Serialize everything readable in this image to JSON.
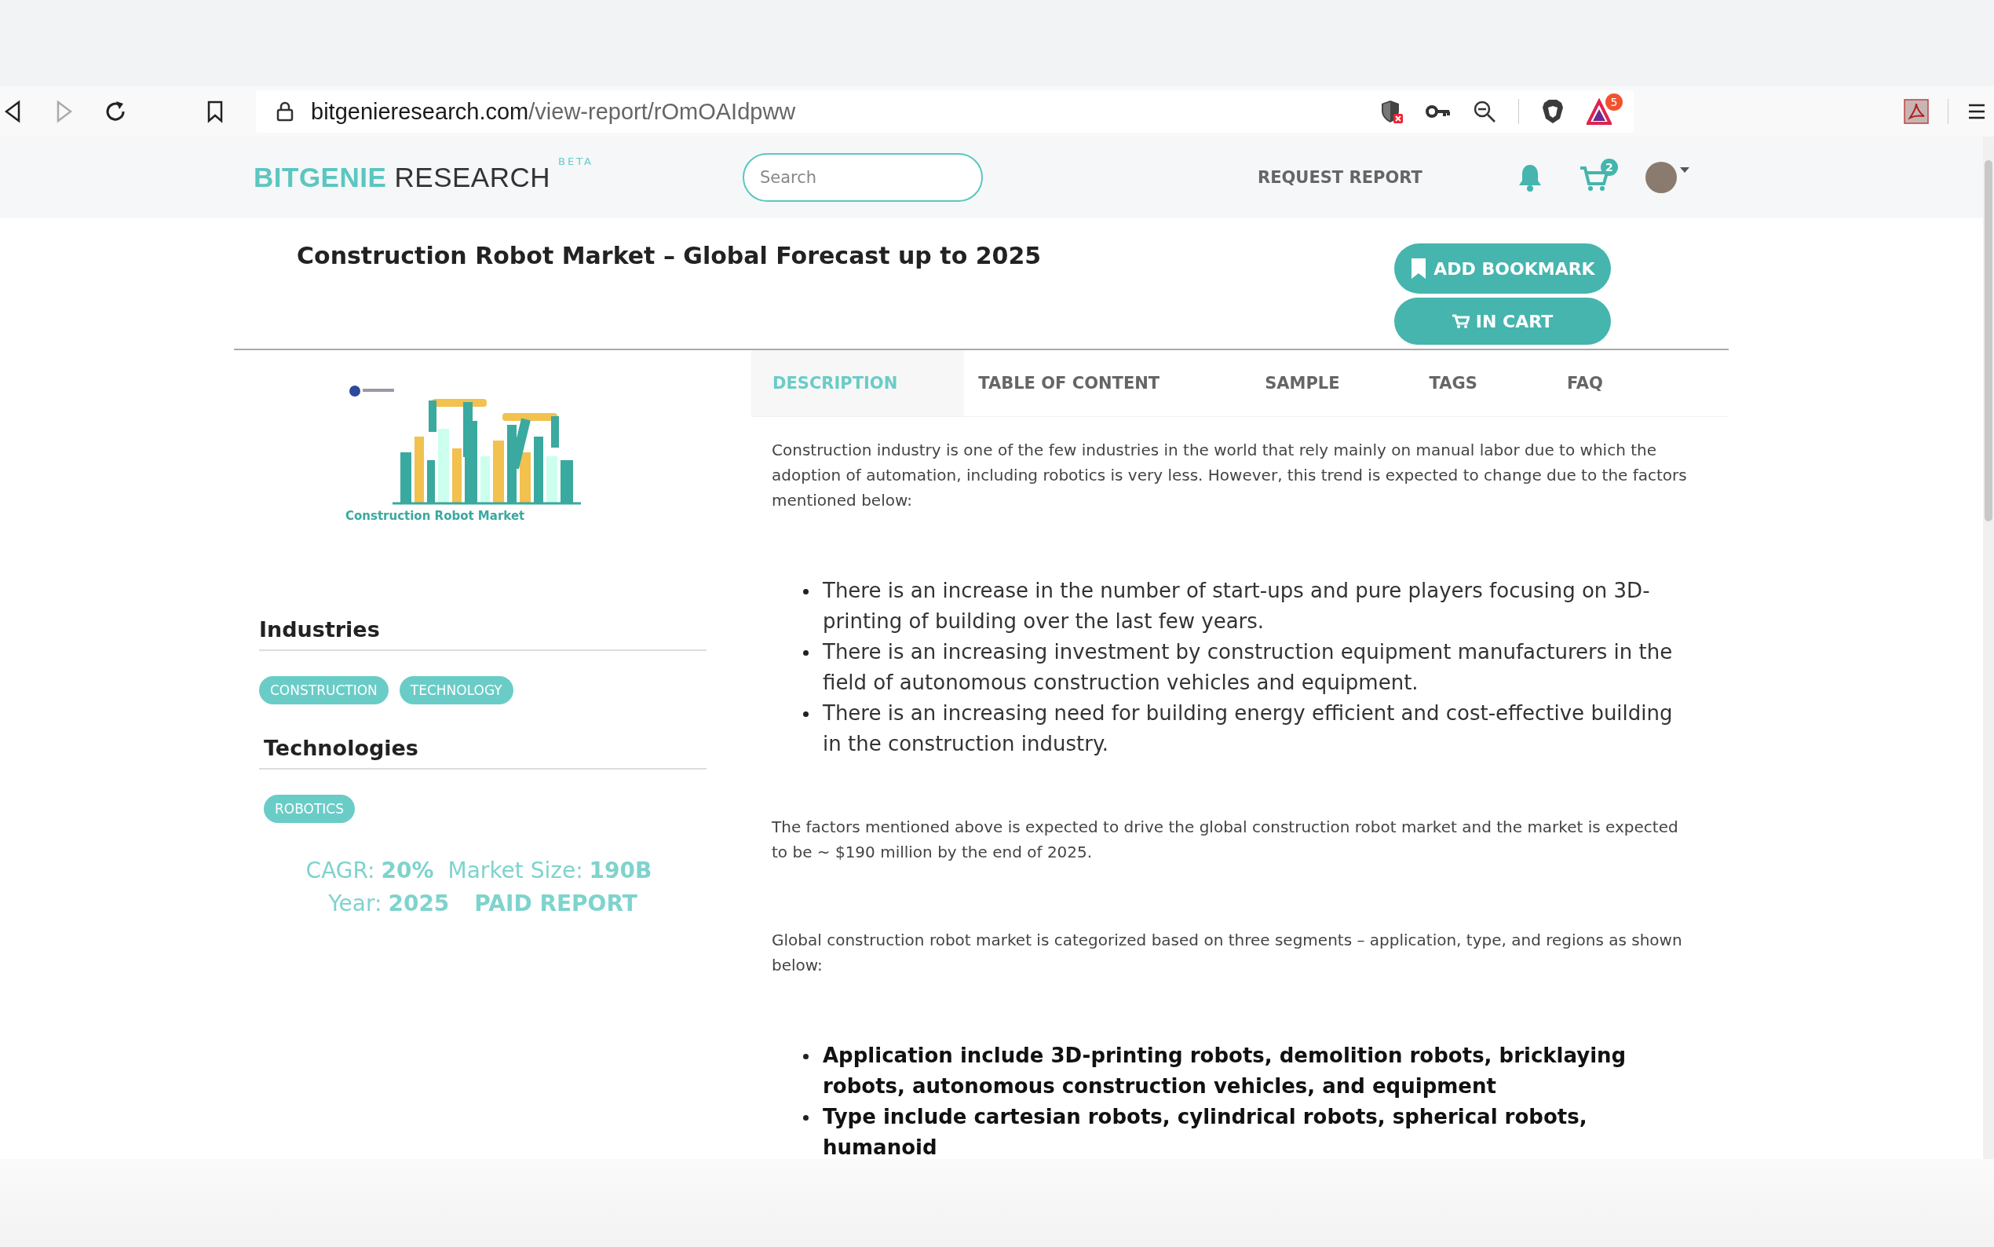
{
  "browser": {
    "url_host": "bitgenieresearch.com",
    "url_path": "/view-report/rOmOAIdpww",
    "back_enabled": true,
    "forward_enabled": false,
    "alert_count": "5"
  },
  "site_header": {
    "logo": {
      "brand": "BITGENIE",
      "word": "RESEARCH",
      "tag": "BETA"
    },
    "search": {
      "placeholder": "Search"
    },
    "nav_link": "REQUEST REPORT",
    "cart_count": "2"
  },
  "report": {
    "title": "Construction Robot Market – Global Forecast up to 2025",
    "actions": [
      {
        "kind": "bookmark",
        "label": "ADD BOOKMARK"
      },
      {
        "kind": "cart",
        "label": "IN CART"
      }
    ],
    "cover": {
      "caption": "Construction Robot Market"
    },
    "sections": [
      {
        "heading": "Industries",
        "tags": [
          "CONSTRUCTION",
          "TECHNOLOGY"
        ]
      },
      {
        "heading": "Technologies",
        "tags": [
          "ROBOTICS"
        ]
      }
    ],
    "stats": [
      {
        "label": "CAGR:",
        "value": "20%"
      },
      {
        "label": "Market Size:",
        "value": "190B"
      },
      {
        "label": "Year:",
        "value": "2025"
      }
    ],
    "access": "PAID REPORT",
    "tabs": [
      {
        "label": "DESCRIPTION",
        "selected": true
      },
      {
        "label": "TABLE OF CONTENT",
        "selected": false
      },
      {
        "label": "SAMPLE",
        "selected": false
      },
      {
        "label": "TAGS",
        "selected": false
      },
      {
        "label": "FAQ",
        "selected": false
      }
    ],
    "description": [
      {
        "kind": "paragraph",
        "text": "Construction industry is one of the few industries in the world that rely mainly on manual labor due to which the adoption of automation, including robotics is very less. However, this trend is expected to change due to the factors mentioned below:"
      },
      {
        "kind": "list",
        "bold": false,
        "items": [
          "There is an increase in the number of start-ups and pure players focusing on 3D-printing of building over the last few years.",
          "There is an increasing investment by construction equipment manufacturers in the field of autonomous construction vehicles and equipment.",
          "There is an increasing need for building energy efficient and cost-effective building in the construction industry."
        ]
      },
      {
        "kind": "paragraph",
        "text": "The factors mentioned above is expected to drive the global construction robot market and the market is expected to be ~ $190 million by the end of 2025."
      },
      {
        "kind": "paragraph",
        "text": "Global construction robot market is categorized based on three segments – application, type, and regions as shown below:"
      },
      {
        "kind": "list",
        "bold": true,
        "items": [
          "Application include 3D-printing robots, demolition robots, bricklaying robots, autonomous construction vehicles, and equipment",
          "Type include cartesian robots, cylindrical robots, spherical robots, humanoid"
        ]
      }
    ]
  }
}
